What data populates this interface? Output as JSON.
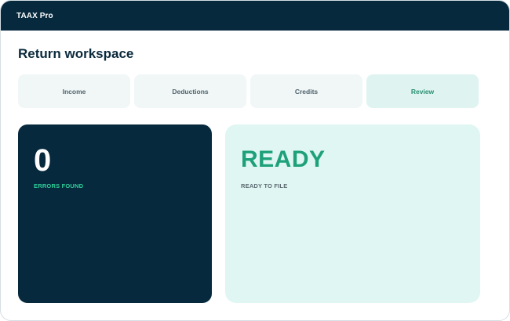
{
  "app": {
    "title": "TAAX Pro"
  },
  "page": {
    "title": "Return workspace"
  },
  "tabs": [
    {
      "label": "Income",
      "active": false
    },
    {
      "label": "Deductions",
      "active": false
    },
    {
      "label": "Credits",
      "active": false
    },
    {
      "label": "Review",
      "active": true
    }
  ],
  "errors_card": {
    "value": "0",
    "caption": "ERRORS FOUND"
  },
  "status_card": {
    "value": "READY",
    "caption": "READY TO FILE"
  },
  "colors": {
    "titlebar": "#06293d",
    "accent_green": "#1ea17a",
    "active_tab_bg": "#dff4f0",
    "status_card_bg": "#dff6f2"
  }
}
